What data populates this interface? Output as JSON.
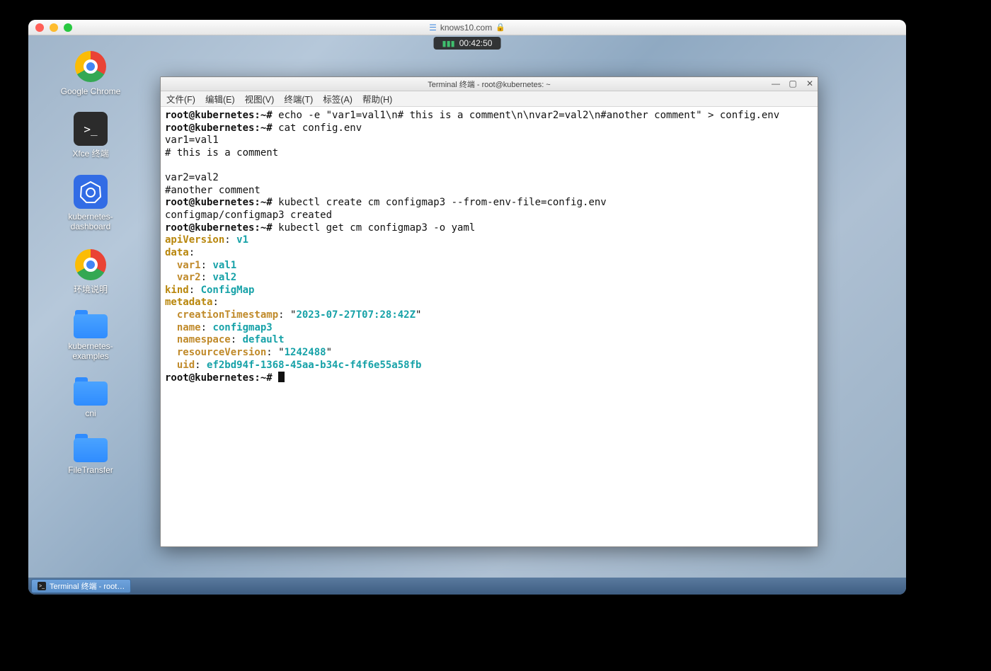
{
  "mac": {
    "url": "knows10.com",
    "clock": "00:42:50"
  },
  "desktop_icons": [
    {
      "name": "google-chrome",
      "label": "Google Chrome"
    },
    {
      "name": "xfce-terminal",
      "label": "Xfce 终端"
    },
    {
      "name": "kubernetes-dashboard",
      "label": "kubernetes-\ndashboard"
    },
    {
      "name": "env-notes",
      "label": "环境说明"
    },
    {
      "name": "kubernetes-examples",
      "label": "kubernetes-\nexamples"
    },
    {
      "name": "cni",
      "label": "cni"
    },
    {
      "name": "filetransfer",
      "label": "FileTransfer"
    }
  ],
  "taskbar": {
    "item": "Terminal 终端 - root…"
  },
  "terminal": {
    "title": "Terminal 终端 - root@kubernetes: ~",
    "menu": [
      "文件(F)",
      "编辑(E)",
      "视图(V)",
      "终端(T)",
      "标签(A)",
      "帮助(H)"
    ],
    "prompt": "root@kubernetes:~#",
    "lines": {
      "l1_cmd": "echo -e \"var1=val1\\n# this is a comment\\n\\nvar2=val2\\n#another comment\" > config.env",
      "l2_cmd": "cat config.env",
      "l3": "var1=val1",
      "l4": "# this is a comment",
      "l5": "",
      "l6": "var2=val2",
      "l7": "#another comment",
      "l8_cmd": "kubectl create cm configmap3 --from-env-file=config.env",
      "l9": "configmap/configmap3 created",
      "l10_cmd": "kubectl get cm configmap3 -o yaml"
    },
    "yaml": {
      "apiVersion": "v1",
      "data": {
        "var1": "val1",
        "var2": "val2"
      },
      "kind": "ConfigMap",
      "metadata": {
        "creationTimestamp": "2023-07-27T07:28:42Z",
        "name": "configmap3",
        "namespace": "default",
        "resourceVersion": "1242488",
        "uid": "ef2bd94f-1368-45aa-b34c-f4f6e55a58fb"
      }
    }
  }
}
